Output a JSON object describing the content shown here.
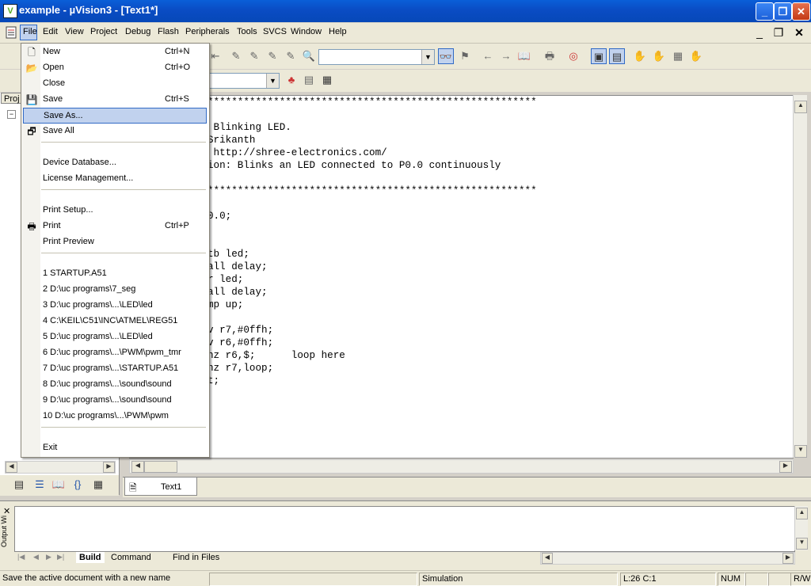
{
  "title_bar": {
    "title": "example  - µVision3 - [Text1*]",
    "app_icon": "V"
  },
  "menubar": {
    "items": [
      "File",
      "Edit",
      "View",
      "Project",
      "Debug",
      "Flash",
      "Peripherals",
      "Tools",
      "SVCS",
      "Window",
      "Help"
    ]
  },
  "project_pane": {
    "tab_label": "Proj"
  },
  "file_menu": {
    "items": [
      {
        "label": "New",
        "shortcut": "Ctrl+N",
        "icon": "new-file-icon"
      },
      {
        "label": "Open",
        "shortcut": "Ctrl+O",
        "icon": "open-folder-icon"
      },
      {
        "label": "Close",
        "shortcut": ""
      },
      {
        "label": "Save",
        "shortcut": "Ctrl+S",
        "icon": "save-disk-icon"
      },
      {
        "label": "Save As...",
        "shortcut": "",
        "selected": true
      },
      {
        "label": "Save All",
        "shortcut": "",
        "icon": "save-all-icon"
      },
      {
        "label": "Device Database...",
        "shortcut": ""
      },
      {
        "label": "License Management...",
        "shortcut": ""
      },
      {
        "label": "Print Setup...",
        "shortcut": ""
      },
      {
        "label": "Print",
        "shortcut": "Ctrl+P",
        "icon": "printer-icon"
      },
      {
        "label": "Print Preview",
        "shortcut": ""
      },
      {
        "label": "1 STARTUP.A51",
        "shortcut": ""
      },
      {
        "label": "2 D:\\uc programs\\7_seg",
        "shortcut": ""
      },
      {
        "label": "3 D:\\uc programs\\...\\LED\\led",
        "shortcut": ""
      },
      {
        "label": "4 C:\\KEIL\\C51\\INC\\ATMEL\\REG51",
        "shortcut": ""
      },
      {
        "label": "5 D:\\uc programs\\...\\LED\\led",
        "shortcut": ""
      },
      {
        "label": "6 D:\\uc programs\\...\\PWM\\pwm_tmr",
        "shortcut": ""
      },
      {
        "label": "7 D:\\uc programs\\...\\STARTUP.A51",
        "shortcut": ""
      },
      {
        "label": "8 D:\\uc programs\\...\\sound\\sound",
        "shortcut": ""
      },
      {
        "label": "9 D:\\uc programs\\...\\sound\\sound",
        "shortcut": ""
      },
      {
        "label": "10 D:\\uc programs\\...\\PWM\\pwm",
        "shortcut": ""
      },
      {
        "label": "Exit",
        "shortcut": ""
      }
    ]
  },
  "editor": {
    "lines": [
      "*******************************************************",
      "",
      " Blinking LED.",
      "Srikanth",
      " http://shree-electronics.com/",
      "ion: Blinks an LED connected to P0.0 continuously",
      "",
      "*******************************************************",
      "",
      "0.0;",
      "",
      "",
      "tb led;",
      "all delay;",
      "r led;",
      "all delay;",
      "mp up;",
      "",
      "v r7,#0ffh;",
      "v r6,#0ffh;",
      "nz r6,$;      loop here",
      "nz r7,loop;",
      "t;"
    ],
    "tab_label": "Text1"
  },
  "output_window": {
    "title": "Output Wi",
    "tabs": [
      "Build",
      "Command",
      "Find in Files"
    ]
  },
  "status_bar": {
    "message": "Save the active document with a new name",
    "mode": "Simulation",
    "position": "L:26 C:1",
    "num": "NUM",
    "rw": "R/W"
  }
}
